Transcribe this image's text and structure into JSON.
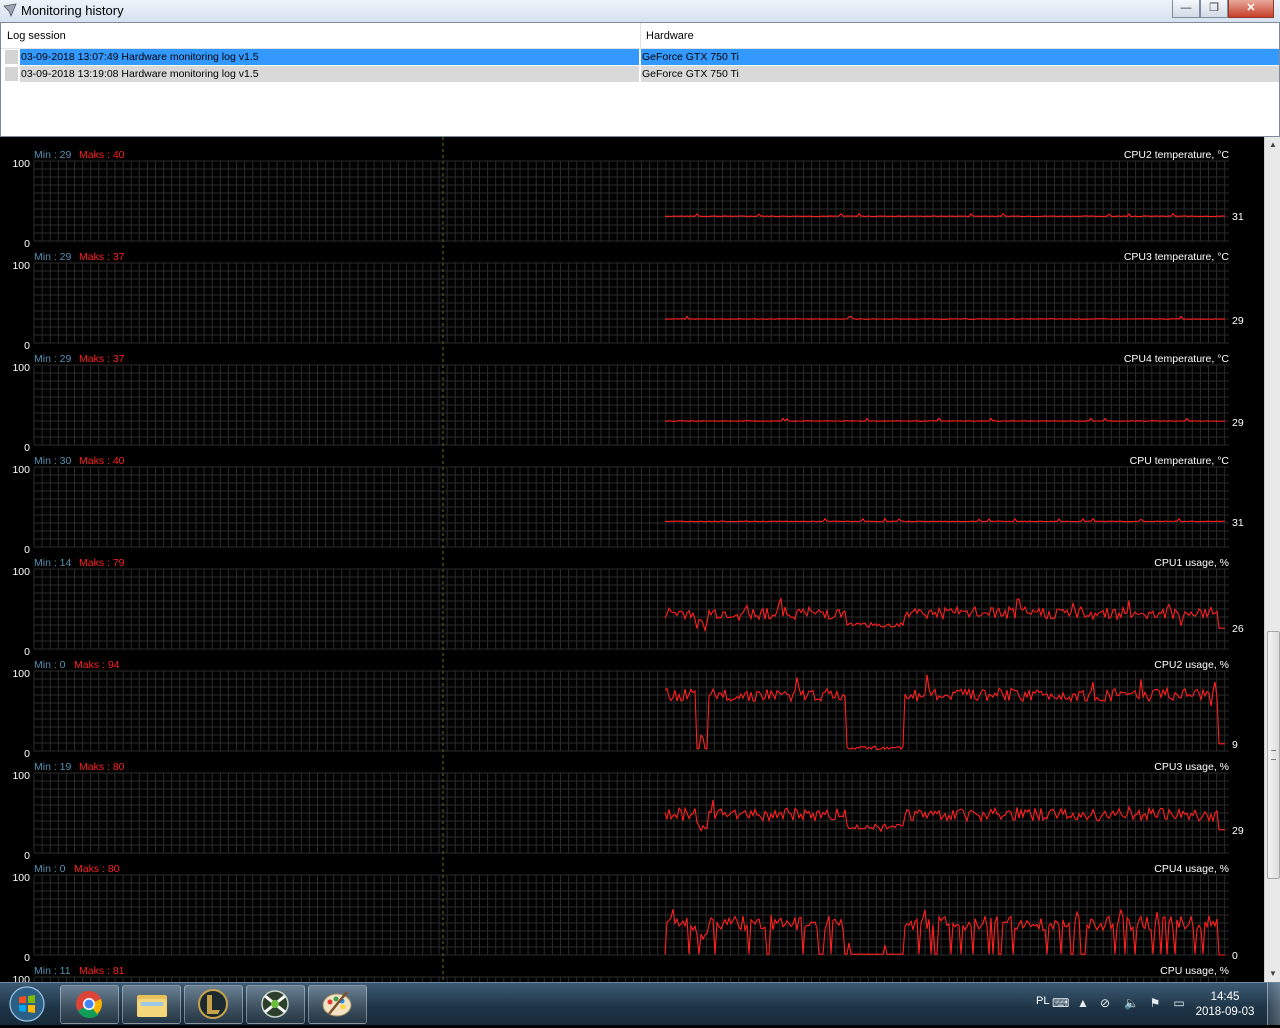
{
  "window": {
    "title": "Monitoring history",
    "buttons": {
      "minimize": "—",
      "maximize": "❐",
      "close": "✕"
    }
  },
  "sessions": {
    "columns": {
      "log": "Log session",
      "hardware": "Hardware"
    },
    "rows": [
      {
        "log": "03-09-2018 13:07:49 Hardware monitoring log v1.5",
        "hardware": "GeForce GTX 750 Ti",
        "selected": true
      },
      {
        "log": "03-09-2018 13:19:08 Hardware monitoring log v1.5",
        "hardware": "GeForce GTX 750 Ti",
        "selected": false
      }
    ]
  },
  "chart_data": [
    {
      "type": "line",
      "title": "CPU2 temperature, °C",
      "min_label": "Min : 29",
      "max_label": "Maks : 40",
      "ylim": [
        0,
        100
      ],
      "y_labels": [
        "100",
        "0"
      ],
      "current": "31",
      "mean": 31,
      "noise": 0.4,
      "profile": "flat"
    },
    {
      "type": "line",
      "title": "CPU3 temperature, °C",
      "min_label": "Min : 29",
      "max_label": "Maks : 37",
      "ylim": [
        0,
        100
      ],
      "y_labels": [
        "100",
        "0"
      ],
      "current": "29",
      "mean": 30,
      "noise": 0.4,
      "profile": "flat"
    },
    {
      "type": "line",
      "title": "CPU4 temperature, °C",
      "min_label": "Min : 29",
      "max_label": "Maks : 37",
      "ylim": [
        0,
        100
      ],
      "y_labels": [
        "100",
        "0"
      ],
      "current": "29",
      "mean": 30,
      "noise": 0.4,
      "profile": "flat"
    },
    {
      "type": "line",
      "title": "CPU temperature, °C",
      "min_label": "Min : 30",
      "max_label": "Maks : 40",
      "ylim": [
        0,
        100
      ],
      "y_labels": [
        "100",
        "0"
      ],
      "current": "31",
      "mean": 32,
      "noise": 0.4,
      "profile": "flat"
    },
    {
      "type": "line",
      "title": "CPU1 usage, %",
      "min_label": "Min : 14",
      "max_label": "Maks : 79",
      "ylim": [
        0,
        100
      ],
      "y_labels": [
        "100",
        "0"
      ],
      "current": "26",
      "mean": 45,
      "noise": 8,
      "profile": "usage"
    },
    {
      "type": "line",
      "title": "CPU2 usage, %",
      "min_label": "Min : 0",
      "max_label": "Maks : 94",
      "ylim": [
        0,
        100
      ],
      "y_labels": [
        "100",
        "0"
      ],
      "current": "9",
      "mean": 70,
      "noise": 8,
      "profile": "heavy"
    },
    {
      "type": "line",
      "title": "CPU3 usage, %",
      "min_label": "Min : 19",
      "max_label": "Maks : 80",
      "ylim": [
        0,
        100
      ],
      "y_labels": [
        "100",
        "0"
      ],
      "current": "29",
      "mean": 48,
      "noise": 8,
      "profile": "usage"
    },
    {
      "type": "line",
      "title": "CPU4 usage, %",
      "min_label": "Min : 0",
      "max_label": "Maks : 80",
      "ylim": [
        0,
        100
      ],
      "y_labels": [
        "100",
        "0"
      ],
      "current": "0",
      "mean": 40,
      "noise": 9,
      "profile": "spiky"
    },
    {
      "type": "line",
      "title": "CPU usage, %",
      "min_label": "Min : 11",
      "max_label": "Maks : 81",
      "ylim": [
        0,
        100
      ],
      "y_labels": [
        "100"
      ],
      "current": "",
      "mean": 45,
      "noise": 8,
      "profile": "usage"
    }
  ],
  "colors": {
    "series": "#ff2020",
    "grid": "#2b2b2b",
    "min_text": "#5a8fb0",
    "max_text": "#ff2020",
    "label": "#ffffff",
    "cursor": "#6b6b2a"
  },
  "taskbar": {
    "items": [
      "windows-start",
      "chrome",
      "file-explorer",
      "league-of-legends",
      "msi-afterburner",
      "paint"
    ],
    "language": "PL",
    "time": "14:45",
    "date": "2018-09-03"
  }
}
